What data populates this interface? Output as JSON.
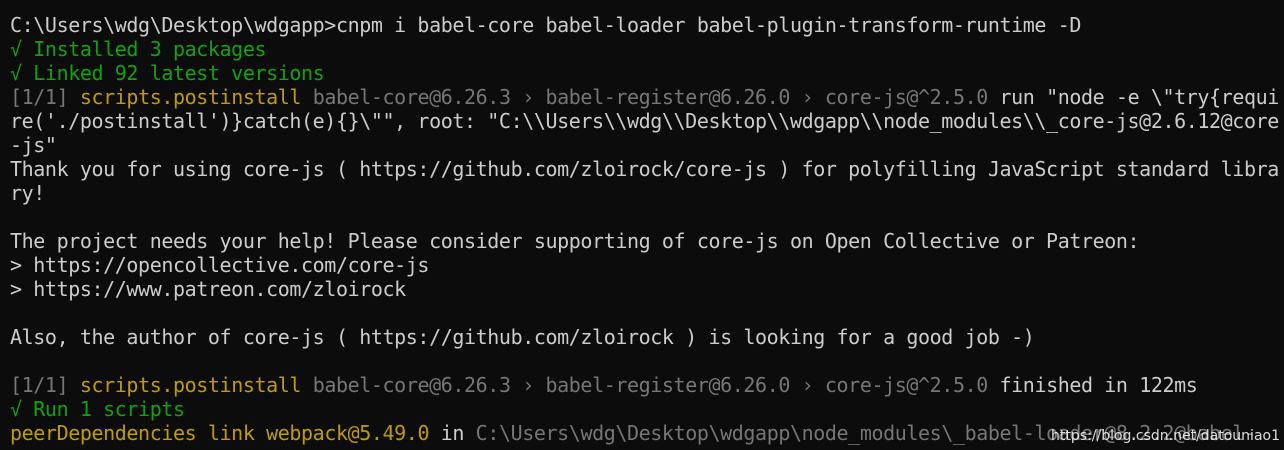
{
  "terminal": {
    "colors": {
      "background": "#0c0c0c",
      "default_text": "#cccccc",
      "gray": "#767676",
      "green": "#13a10e",
      "yellow": "#c19c00"
    },
    "lines": [
      [
        {
          "text": "C:\\Users\\wdg\\Desktop\\wdgapp>cnpm i babel-core babel-loader babel-plugin-transform-runtime -D",
          "color": "white"
        }
      ],
      [
        {
          "text": "√ Installed 3 packages",
          "color": "green"
        }
      ],
      [
        {
          "text": "√ Linked 92 latest versions",
          "color": "green"
        }
      ],
      [
        {
          "text": "[1/1] ",
          "color": "gray"
        },
        {
          "text": "scripts.postinstall",
          "color": "yellow"
        },
        {
          "text": " babel-core@6.26.3 › babel-register@6.26.0 › core-js@^2.5.0 ",
          "color": "gray"
        },
        {
          "text": "run \"node -e \\\"try{requi",
          "color": "white"
        }
      ],
      [
        {
          "text": "re('./postinstall')}catch(e){}\\\"\", root: \"C:\\\\Users\\\\wdg\\\\Desktop\\\\wdgapp\\\\node_modules\\\\_core-js@2.6.12@core",
          "color": "white"
        }
      ],
      [
        {
          "text": "-js\"",
          "color": "white"
        }
      ],
      [
        {
          "text": "Thank you for using core-js ( https://github.com/zloirock/core-js ) for polyfilling JavaScript standard libra",
          "color": "white"
        }
      ],
      [
        {
          "text": "ry!",
          "color": "white"
        }
      ],
      [
        {
          "text": "",
          "color": "white"
        }
      ],
      [
        {
          "text": "The project needs your help! Please consider supporting of core-js on Open Collective or Patreon:",
          "color": "white"
        }
      ],
      [
        {
          "text": "> https://opencollective.com/core-js",
          "color": "white"
        }
      ],
      [
        {
          "text": "> https://www.patreon.com/zloirock",
          "color": "white"
        }
      ],
      [
        {
          "text": "",
          "color": "white"
        }
      ],
      [
        {
          "text": "Also, the author of core-js ( https://github.com/zloirock ) is looking for a good job -)",
          "color": "white"
        }
      ],
      [
        {
          "text": "",
          "color": "white"
        }
      ],
      [
        {
          "text": "[1/1] ",
          "color": "gray"
        },
        {
          "text": "scripts.postinstall",
          "color": "yellow"
        },
        {
          "text": " babel-core@6.26.3 › babel-register@6.26.0 › core-js@^2.5.0 ",
          "color": "gray"
        },
        {
          "text": "finished in 122ms",
          "color": "white"
        }
      ],
      [
        {
          "text": "√ Run 1 scripts",
          "color": "green"
        }
      ],
      [
        {
          "text": "peerDependencies link ",
          "color": "yellow"
        },
        {
          "text": "webpack@5.49.0",
          "color": "yellow"
        },
        {
          "text": " in ",
          "color": "white"
        },
        {
          "text": "C:\\Users\\wdg\\Desktop\\wdgapp\\node_modules\\_babel-loader@8.2.2@babel-",
          "color": "gray"
        }
      ]
    ]
  },
  "watermark": "https://blog.csdn.net/datouniao1"
}
